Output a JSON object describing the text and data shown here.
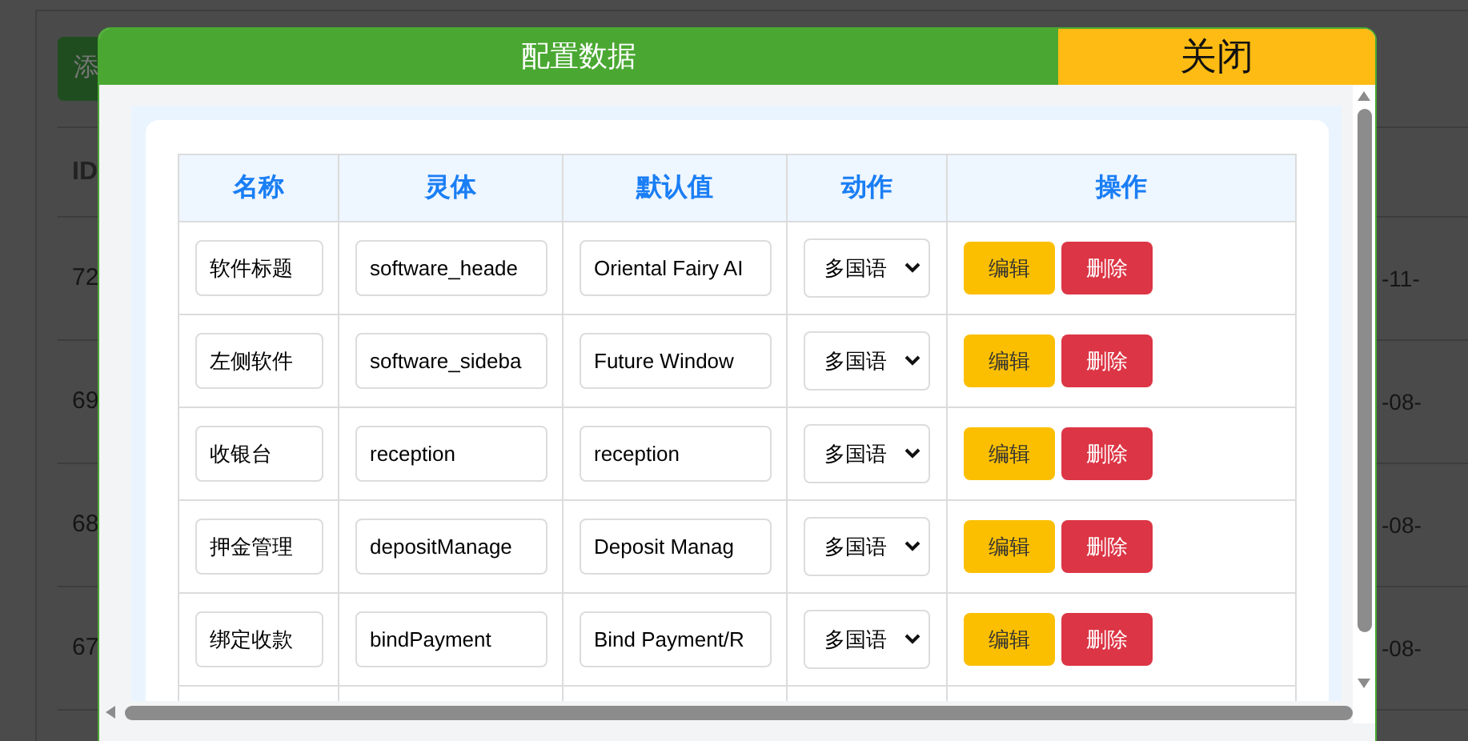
{
  "background": {
    "add_button": "添",
    "id_header": "ID",
    "rows": [
      {
        "id": "72",
        "date": "-11-"
      },
      {
        "id": "69",
        "date": "-08-"
      },
      {
        "id": "68",
        "date": "-08-"
      },
      {
        "id": "67",
        "date": "-08-"
      }
    ]
  },
  "dialog": {
    "title": "配置数据",
    "close": "关闭",
    "columns": [
      "名称",
      "灵体",
      "默认值",
      "动作",
      "操作"
    ],
    "rows": [
      {
        "name": "软件标题",
        "key": "software_heade",
        "default": "Oriental Fairy AI",
        "action": "多国语",
        "edit": "编辑",
        "delete": "删除"
      },
      {
        "name": "左侧软件",
        "key": "software_sideba",
        "default": "Future Window",
        "action": "多国语",
        "edit": "编辑",
        "delete": "删除"
      },
      {
        "name": "收银台",
        "key": "reception",
        "default": "reception",
        "action": "多国语",
        "edit": "编辑",
        "delete": "删除"
      },
      {
        "name": "押金管理",
        "key": "depositManage",
        "default": "Deposit Manag",
        "action": "多国语",
        "edit": "编辑",
        "delete": "删除"
      },
      {
        "name": "绑定收款",
        "key": "bindPayment",
        "default": "Bind Payment/R",
        "action": "多国语",
        "edit": "编辑",
        "delete": "删除"
      }
    ]
  }
}
